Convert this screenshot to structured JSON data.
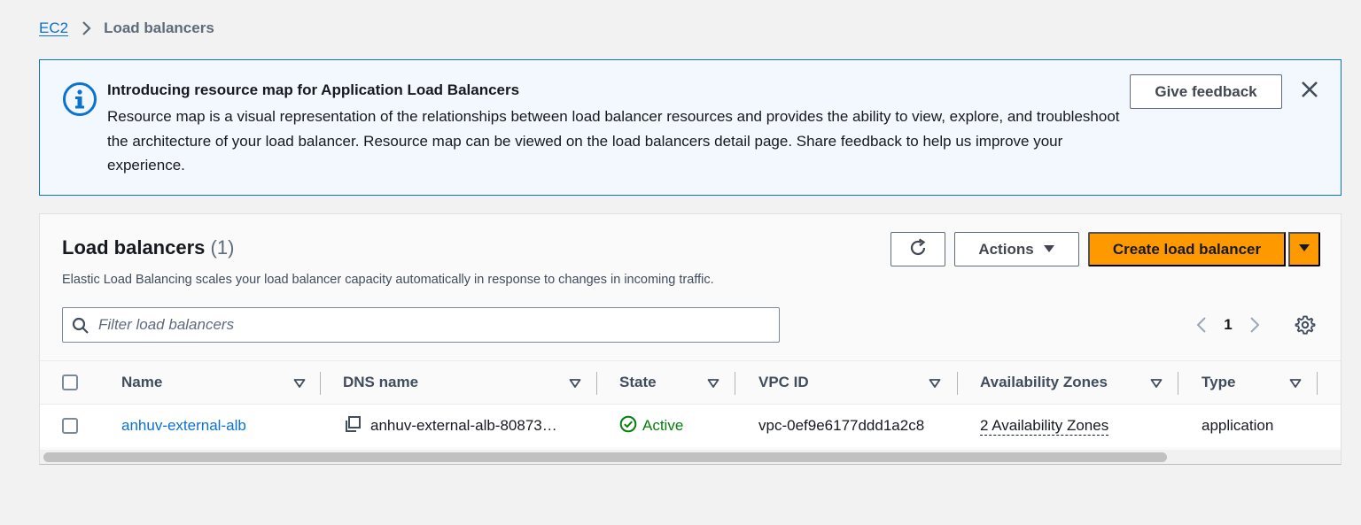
{
  "breadcrumb": {
    "parent": "EC2",
    "current": "Load balancers"
  },
  "banner": {
    "title": "Introducing resource map for Application Load Balancers",
    "body": "Resource map is a visual representation of the relationships between load balancer resources and provides the ability to view, explore, and troubleshoot the architecture of your load balancer. Resource map can be viewed on the load balancers detail page. Share feedback to help us improve your experience.",
    "feedback_label": "Give feedback"
  },
  "panel": {
    "title": "Load balancers",
    "count": "(1)",
    "description": "Elastic Load Balancing scales your load balancer capacity automatically in response to changes in incoming traffic.",
    "actions_label": "Actions",
    "create_label": "Create load balancer"
  },
  "search": {
    "placeholder": "Filter load balancers"
  },
  "pagination": {
    "current_page": "1"
  },
  "table": {
    "columns": [
      "Name",
      "DNS name",
      "State",
      "VPC ID",
      "Availability Zones",
      "Type"
    ],
    "rows": [
      {
        "name": "anhuv-external-alb",
        "dns_name": "anhuv-external-alb-80873…",
        "state": "Active",
        "vpc_id": "vpc-0ef9e6177ddd1a2c8",
        "availability_zones": "2 Availability Zones",
        "type": "application"
      }
    ]
  },
  "colors": {
    "accent": "#0972d3",
    "primary_button": "#ff9900",
    "success": "#037f0c",
    "banner_bg": "#f2f8fd"
  },
  "icons": [
    "chevron-right-icon",
    "info-icon",
    "close-icon",
    "refresh-icon",
    "caret-down-icon",
    "search-icon",
    "chevron-left-icon",
    "settings-icon",
    "sort-icon",
    "copy-icon",
    "status-positive-icon"
  ]
}
